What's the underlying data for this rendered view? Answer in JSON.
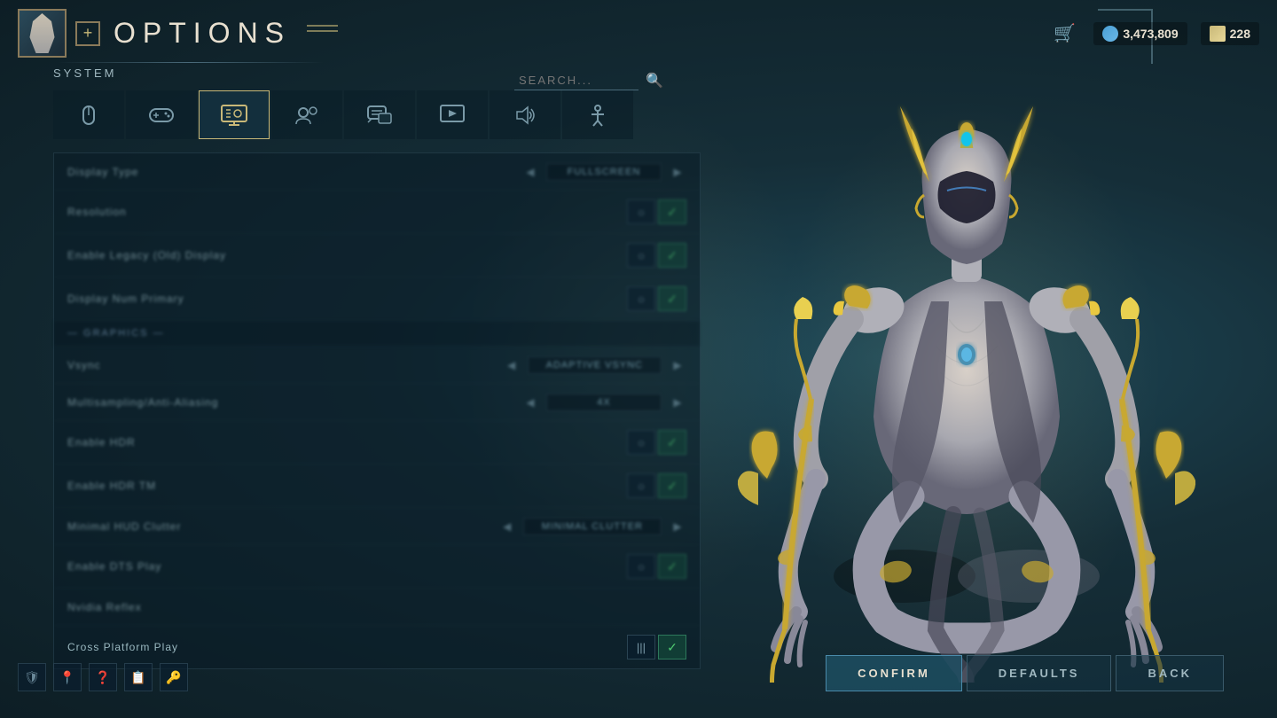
{
  "header": {
    "title": "OPTIONS",
    "add_btn": "+",
    "cart_label": "cart",
    "currency": {
      "credits": "3,473,809",
      "platinum": "228"
    }
  },
  "search": {
    "placeholder": "SEARCH...",
    "icon": "🔍"
  },
  "section_label": "SYSTEM",
  "tabs": [
    {
      "id": "mouse",
      "label": "🖱",
      "icon_name": "mouse-icon",
      "active": false
    },
    {
      "id": "controller",
      "label": "🎮",
      "icon_name": "controller-icon",
      "active": false
    },
    {
      "id": "display",
      "label": "🖥",
      "icon_name": "display-icon",
      "active": true
    },
    {
      "id": "social",
      "label": "👥",
      "icon_name": "social-icon",
      "active": false
    },
    {
      "id": "chat",
      "label": "💬",
      "icon_name": "chat-icon",
      "active": false
    },
    {
      "id": "stream",
      "label": "▶",
      "icon_name": "stream-icon",
      "active": false
    },
    {
      "id": "audio",
      "label": "🔊",
      "icon_name": "audio-icon",
      "active": false
    },
    {
      "id": "accessibility",
      "label": "♿",
      "icon_name": "accessibility-icon",
      "active": false
    }
  ],
  "settings": [
    {
      "id": "display-type",
      "label": "Display Type",
      "type": "select",
      "value": "FULLSCREEN",
      "blurred": true
    },
    {
      "id": "resolution",
      "label": "Resolution",
      "type": "toggle-check",
      "blurred": true
    },
    {
      "id": "display-legacy",
      "label": "Enable Legacy (Old) Display",
      "type": "toggle-check",
      "blurred": true
    },
    {
      "id": "display-num-primary",
      "label": "Display Num Primary",
      "type": "toggle-check",
      "blurred": true
    },
    {
      "id": "section-graphics",
      "label": "— GRAPHICS —",
      "type": "section",
      "blurred": true
    },
    {
      "id": "vsync",
      "label": "Vsync",
      "type": "select",
      "value": "ADAPTIVE VSYNC",
      "blurred": true
    },
    {
      "id": "multisampling",
      "label": "Multisampling/Anti-Aliasing",
      "type": "select",
      "value": "4X",
      "blurred": true
    },
    {
      "id": "enable-hdr",
      "label": "Enable HDR",
      "type": "toggle-check",
      "blurred": true
    },
    {
      "id": "enable-hdr-tm",
      "label": "Enable HDR TM",
      "type": "toggle-check",
      "blurred": true
    },
    {
      "id": "minimal-hud",
      "label": "Minimal HUD Clutter",
      "type": "select",
      "value": "MINIMAL CLUTTER",
      "blurred": true
    },
    {
      "id": "enable-dts-play",
      "label": "Enable DTS Play",
      "type": "toggle-check",
      "blurred": true
    },
    {
      "id": "nvidia-reflex",
      "label": "Nvidia Reflex",
      "type": "text",
      "blurred": true
    },
    {
      "id": "cross-platform",
      "label": "Cross Platform Play",
      "type": "toggle-check",
      "blurred": false
    }
  ],
  "bottom_buttons": {
    "confirm": "CONFIRM",
    "defaults": "DEFAULTS",
    "back": "BACK"
  },
  "bottom_icons": [
    "🛡",
    "📍",
    "❓",
    "📋",
    "🔑"
  ],
  "colors": {
    "accent": "#c8b878",
    "active_tab_border": "#c8b878",
    "bg_dark": "#0d1e25",
    "text_primary": "#e8e0d0",
    "text_secondary": "#9ab8c0"
  }
}
